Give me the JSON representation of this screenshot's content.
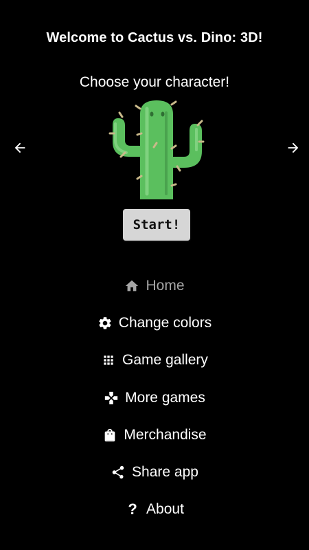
{
  "header": {
    "title": "Welcome to Cactus vs. Dino: 3D!",
    "subtitle": "Choose your character!"
  },
  "character": {
    "icon": "cactus-icon"
  },
  "navigation": {
    "prev_icon": "arrow-left-icon",
    "next_icon": "arrow-right-icon"
  },
  "start_button": {
    "label": "Start!"
  },
  "menu": {
    "items": [
      {
        "label": "Home",
        "icon": "home-icon",
        "active": true
      },
      {
        "label": "Change colors",
        "icon": "gear-icon"
      },
      {
        "label": "Game gallery",
        "icon": "grid-icon"
      },
      {
        "label": "More games",
        "icon": "gamepad-icon"
      },
      {
        "label": "Merchandise",
        "icon": "shopping-bag-icon"
      },
      {
        "label": "Share app",
        "icon": "share-icon"
      },
      {
        "label": "About",
        "icon": "question-icon"
      }
    ]
  },
  "colors": {
    "background": "#000000",
    "text": "#ffffff",
    "active_menu_text": "#a6a6a6",
    "button_bg": "#d6d6d6",
    "cactus_green": "#5bbf5e"
  }
}
